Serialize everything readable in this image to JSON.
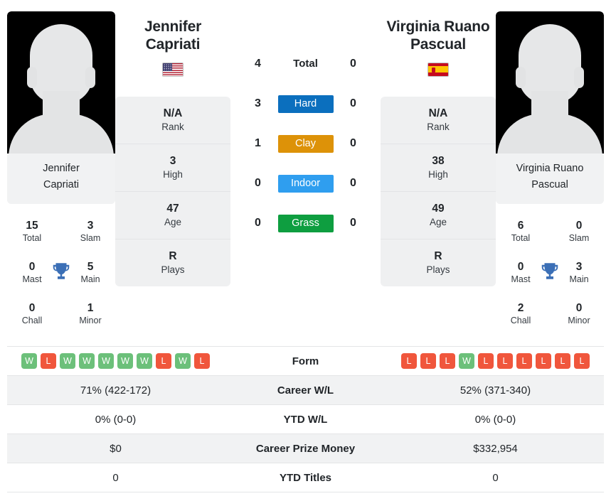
{
  "colors": {
    "hard": "#0b6fbe",
    "clay": "#dd9208",
    "indoor": "#2f9eef",
    "grass": "#0e9e40",
    "win": "#6cc07a",
    "loss": "#f0563c",
    "trophy": "#3b6fb6",
    "panel": "#eff0f1"
  },
  "players": {
    "left": {
      "first_name": "Jennifer",
      "last_name": "Capriati",
      "full_name": "Jennifer Capriati",
      "caption_line1": "Jennifer",
      "caption_line2": "Capriati",
      "flag": "us-flag",
      "titles": {
        "total_value": "15",
        "total_label": "Total",
        "slam_value": "3",
        "slam_label": "Slam",
        "mast_value": "0",
        "mast_label": "Mast",
        "main_value": "5",
        "main_label": "Main",
        "chall_value": "0",
        "chall_label": "Chall",
        "minor_value": "1",
        "minor_label": "Minor"
      },
      "attributes": [
        {
          "value": "N/A",
          "label": "Rank"
        },
        {
          "value": "3",
          "label": "High"
        },
        {
          "value": "47",
          "label": "Age"
        },
        {
          "value": "R",
          "label": "Plays"
        }
      ],
      "form": [
        "W",
        "L",
        "W",
        "W",
        "W",
        "W",
        "W",
        "L",
        "W",
        "L"
      ],
      "career_wl": "71% (422-172)",
      "ytd_wl": "0% (0-0)",
      "career_prize_money": "$0",
      "ytd_titles": "0"
    },
    "right": {
      "first_name": "Virginia Ruano",
      "last_name": "Pascual",
      "full_name": "Virginia Ruano Pascual",
      "caption_line1": "Virginia Ruano",
      "caption_line2": "Pascual",
      "flag": "es-flag",
      "titles": {
        "total_value": "6",
        "total_label": "Total",
        "slam_value": "0",
        "slam_label": "Slam",
        "mast_value": "0",
        "mast_label": "Mast",
        "main_value": "3",
        "main_label": "Main",
        "chall_value": "2",
        "chall_label": "Chall",
        "minor_value": "0",
        "minor_label": "Minor"
      },
      "attributes": [
        {
          "value": "N/A",
          "label": "Rank"
        },
        {
          "value": "38",
          "label": "High"
        },
        {
          "value": "49",
          "label": "Age"
        },
        {
          "value": "R",
          "label": "Plays"
        }
      ],
      "form": [
        "L",
        "L",
        "L",
        "W",
        "L",
        "L",
        "L",
        "L",
        "L",
        "L"
      ],
      "career_wl": "52% (371-340)",
      "ytd_wl": "0% (0-0)",
      "career_prize_money": "$332,954",
      "ytd_titles": "0"
    }
  },
  "surface_comparison": [
    {
      "label": "Total",
      "left": "4",
      "right": "0",
      "style": "plain",
      "color": ""
    },
    {
      "label": "Hard",
      "left": "3",
      "right": "0",
      "style": "badge",
      "color": "#0b6fbe"
    },
    {
      "label": "Clay",
      "left": "1",
      "right": "0",
      "style": "badge",
      "color": "#dd9208"
    },
    {
      "label": "Indoor",
      "left": "0",
      "right": "0",
      "style": "badge",
      "color": "#2f9eef"
    },
    {
      "label": "Grass",
      "left": "0",
      "right": "0",
      "style": "badge",
      "color": "#0e9e40"
    }
  ],
  "comparison_rows": [
    {
      "label": "Form",
      "left": "",
      "right": "",
      "type": "form",
      "shaded": false
    },
    {
      "label": "Career W/L",
      "left": "71% (422-172)",
      "right": "52% (371-340)",
      "type": "text",
      "shaded": true
    },
    {
      "label": "YTD W/L",
      "left": "0% (0-0)",
      "right": "0% (0-0)",
      "type": "text",
      "shaded": false
    },
    {
      "label": "Career Prize Money",
      "left": "$0",
      "right": "$332,954",
      "type": "text",
      "shaded": true
    },
    {
      "label": "YTD Titles",
      "left": "0",
      "right": "0",
      "type": "text",
      "shaded": false
    }
  ]
}
